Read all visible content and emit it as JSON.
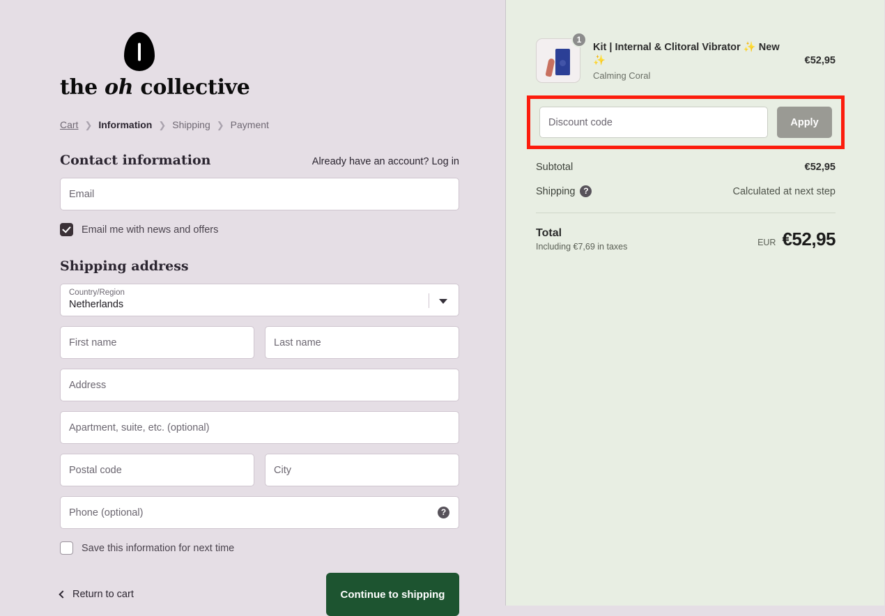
{
  "brand": {
    "logo_name": "the oh collective",
    "logo_word_1": "the ",
    "logo_word_italic": "oh",
    "logo_word_2": " collective"
  },
  "breadcrumb": [
    {
      "label": "Cart",
      "active": false
    },
    {
      "label": "Information",
      "active": true
    },
    {
      "label": "Shipping",
      "active": false
    },
    {
      "label": "Payment",
      "active": false
    }
  ],
  "contact": {
    "title": "Contact information",
    "login_prompt": "Already have an account?",
    "login_link": "Log in",
    "email_placeholder": "Email",
    "email_value": "",
    "newsletter_label": "Email me with news and offers",
    "newsletter_checked": true
  },
  "shipping": {
    "title": "Shipping address",
    "country_label": "Country/Region",
    "country_value": "Netherlands",
    "first_name_placeholder": "First name",
    "last_name_placeholder": "Last name",
    "address_placeholder": "Address",
    "apartment_placeholder": "Apartment, suite, etc. (optional)",
    "postal_placeholder": "Postal code",
    "city_placeholder": "City",
    "phone_placeholder": "Phone (optional)",
    "phone_help_icon": "question-mark-icon",
    "save_info_label": "Save this information for next time",
    "save_info_checked": false
  },
  "footer": {
    "return_label": "Return to cart",
    "continue_label": "Continue to shipping"
  },
  "order": {
    "item": {
      "title": "Kit | Internal & Clitoral Vibrator",
      "title_badge_pre": "✨",
      "title_badge_word": "New",
      "title_badge_post": "✨",
      "variant": "Calming Coral",
      "quantity": "1",
      "price": "€52,95"
    },
    "discount": {
      "placeholder": "Discount code",
      "value": "",
      "apply_label": "Apply"
    },
    "subtotal_label": "Subtotal",
    "subtotal_value": "€52,95",
    "shipping_label": "Shipping",
    "shipping_help_icon": "question-mark-icon",
    "shipping_value": "Calculated at next step",
    "total_label": "Total",
    "total_taxes": "Including €7,69 in taxes",
    "total_currency": "EUR",
    "total_value": "€52,95"
  },
  "colors": {
    "left_background": "#e5dee5",
    "right_background": "#e8eee3",
    "cta_green": "#1d5430",
    "apply_grey": "#9a9a94",
    "highlight_red": "#fc1c0d",
    "checkbox_dark": "#3b3137"
  }
}
